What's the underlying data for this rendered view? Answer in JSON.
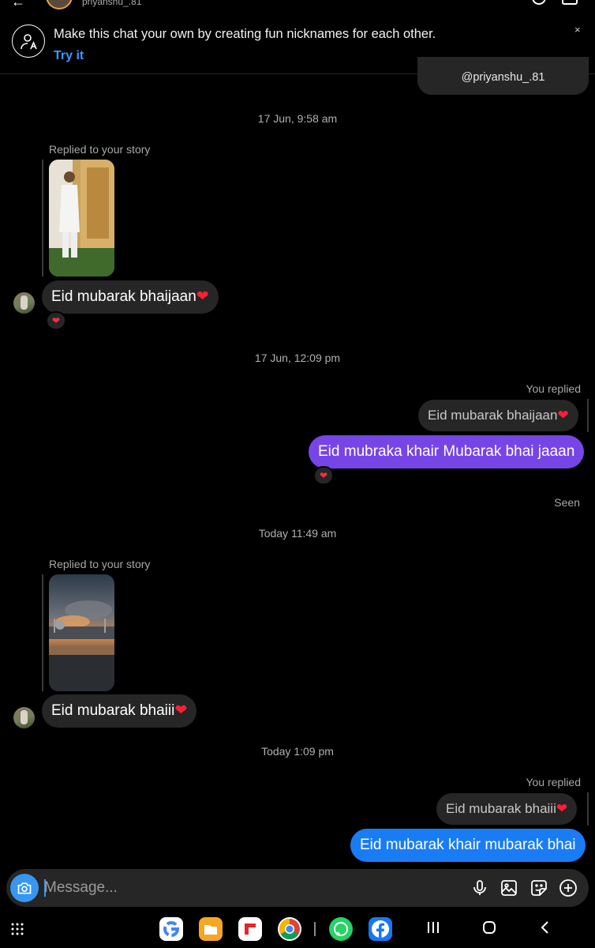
{
  "header": {
    "username": "priyanshu_.81"
  },
  "banner": {
    "text": "Make this chat your own by creating fun nicknames for each other.",
    "action": "Try it",
    "close": "×"
  },
  "shared_profile": {
    "handle": "@priyanshu_.81"
  },
  "conversation": {
    "ts1": "17 Jun, 9:58 am",
    "story_reply_label_1": "Replied to your story",
    "msg_in_1": "Eid mubarak bhaijaan",
    "reaction_1": "❤",
    "ts2": "17 Jun, 12:09 pm",
    "you_replied_1": "You replied",
    "quoted_1": "Eid mubarak bhaijaan",
    "msg_out_1": "Eid mubraka khair Mubarak bhai jaaan",
    "reaction_2": "❤",
    "seen": "Seen",
    "ts3": "Today 11:49 am",
    "story_reply_label_2": "Replied to your story",
    "msg_in_2": "Eid mubarak bhaiii",
    "ts4": "Today 1:09 pm",
    "you_replied_2": "You replied",
    "quoted_2": "Eid mubarak bhaiii",
    "msg_out_2": "Eid mubarak khair mubarak bhai",
    "heart": "❤"
  },
  "composer": {
    "placeholder": "Message..."
  },
  "icons": {
    "camera": "camera-icon",
    "mic": "microphone-icon",
    "gallery": "gallery-icon",
    "sticker": "sticker-icon",
    "plus": "plus-icon"
  },
  "colors": {
    "outgoing_purple": "#7745e6",
    "outgoing_blue": "#1a7cf5",
    "incoming": "#262626",
    "accent": "#3797f0"
  }
}
